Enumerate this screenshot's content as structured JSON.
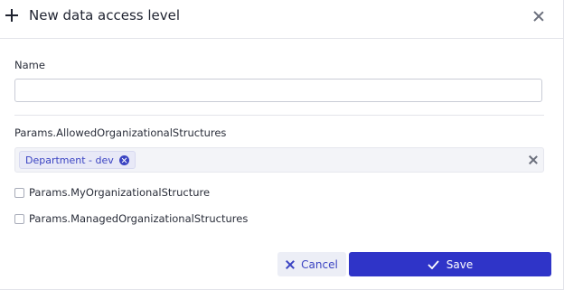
{
  "dialog": {
    "title": "New data access level"
  },
  "form": {
    "name_label": "Name",
    "name_value": "",
    "allowed_label": "Params.AllowedOrganizationalStructures",
    "allowed_tags": [
      "Department - dev"
    ],
    "my_structure_label": "Params.MyOrganizationalStructure",
    "managed_structures_label": "Params.ManagedOrganizationalStructures"
  },
  "footer": {
    "cancel_label": "Cancel",
    "save_label": "Save"
  },
  "colors": {
    "accent": "#2f34c8",
    "tag_text": "#3a43c2"
  },
  "icons": [
    "plus-icon",
    "close-icon",
    "tag-remove-icon",
    "clear-icon",
    "x-icon",
    "check-icon"
  ]
}
